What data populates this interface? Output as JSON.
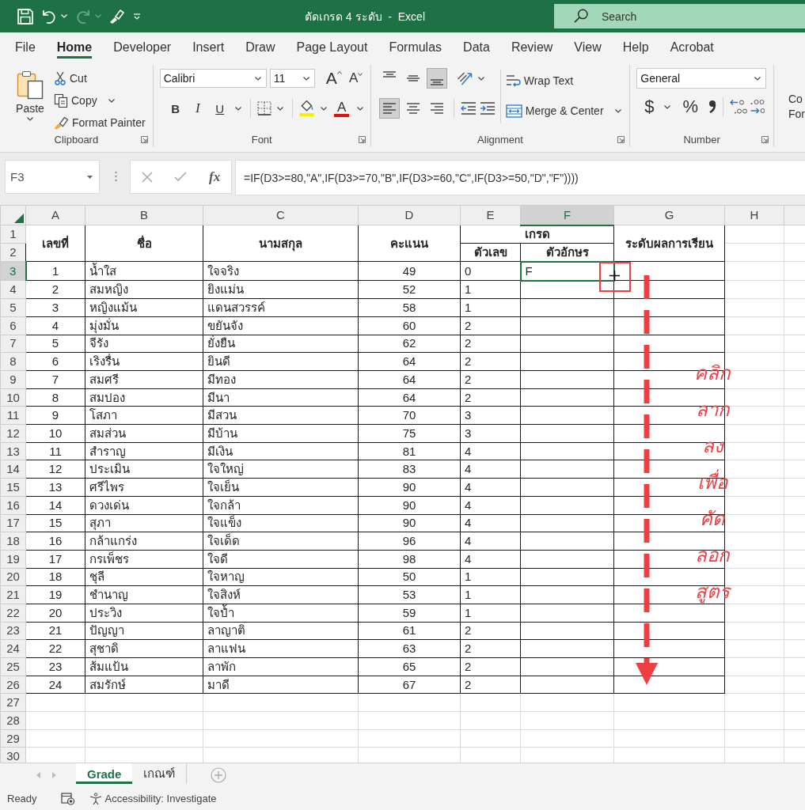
{
  "title_bar": {
    "quick_access": [
      {
        "kind": "save",
        "disabled": false
      },
      {
        "kind": "undo",
        "disabled": false
      },
      {
        "kind": "redo",
        "disabled": true
      },
      {
        "kind": "painter",
        "disabled": false
      },
      {
        "kind": "customize",
        "disabled": false
      }
    ],
    "title": "ตัดเกรด 4 ระดับ  -  Excel",
    "search": {
      "placeholder": "Search"
    }
  },
  "menu_tabs": [
    {
      "label": "File",
      "selected": false
    },
    {
      "label": "Home",
      "selected": true
    },
    {
      "label": "Developer",
      "selected": false
    },
    {
      "label": "Insert",
      "selected": false
    },
    {
      "label": "Draw",
      "selected": false
    },
    {
      "label": "Page Layout",
      "selected": false
    },
    {
      "label": "Formulas",
      "selected": false
    },
    {
      "label": "Data",
      "selected": false
    },
    {
      "label": "Review",
      "selected": false
    },
    {
      "label": "View",
      "selected": false
    },
    {
      "label": "Help",
      "selected": false
    },
    {
      "label": "Acrobat",
      "selected": false
    }
  ],
  "ribbon": {
    "clipboard": {
      "label": "Clipboard",
      "paste": "Paste",
      "cut": "Cut",
      "copy": "Copy",
      "format_painter": "Format Painter"
    },
    "font": {
      "label": "Font",
      "font_name": "Calibri",
      "font_size": "11",
      "grow": "A",
      "shrink": "A",
      "bold": "B",
      "italic": "I",
      "underline": "U",
      "font_color": "A"
    },
    "alignment": {
      "label": "Alignment",
      "vertical": [
        {
          "kind": "top",
          "selected": false
        },
        {
          "kind": "middle",
          "selected": false
        },
        {
          "kind": "bottom",
          "selected": true
        }
      ],
      "horizontal": [
        {
          "kind": "left",
          "selected": true
        },
        {
          "kind": "center",
          "selected": false
        },
        {
          "kind": "right",
          "selected": false
        }
      ],
      "wrap_text": "Wrap Text",
      "merge_center": "Merge & Center"
    },
    "number": {
      "label": "Number",
      "format": "General",
      "currency": "$",
      "percent": "%"
    },
    "next_group": [
      "Co",
      "For"
    ]
  },
  "formula_bar": {
    "name_box": "F3",
    "buttons": [
      {
        "kind": "cancel",
        "disabled": true
      },
      {
        "kind": "enter",
        "disabled": true
      }
    ],
    "function_label": "fx",
    "formula": "=IF(D3>=80,\"A\",IF(D3>=70,\"B\",IF(D3>=60,\"C\",IF(D3>=50,\"D\",\"F\"))))"
  },
  "sheet": {
    "columns": [
      {
        "label": "A",
        "selected": false
      },
      {
        "label": "B",
        "selected": false
      },
      {
        "label": "C",
        "selected": false
      },
      {
        "label": "D",
        "selected": false
      },
      {
        "label": "E",
        "selected": false
      },
      {
        "label": "F",
        "selected": true
      },
      {
        "label": "G",
        "selected": false
      },
      {
        "label": "H",
        "selected": false
      }
    ],
    "header_rows": [
      "1",
      "2"
    ],
    "header": {
      "number": "เลขที่",
      "first_name": "ชื่อ",
      "last_name": "นามสกุล",
      "score": "คะแนน",
      "grade": "เกรด",
      "grade_number": "ตัวเลข",
      "grade_letter": "ตัวอักษร",
      "result_level": "ระดับผลการเรียน"
    },
    "rows": [
      {
        "row": "3",
        "selected": true,
        "no": "1",
        "first_name": "น้ำใส",
        "last_name": "ใจจริง",
        "score": "49",
        "grade_number": "0",
        "grade_letter": "F"
      },
      {
        "row": "4",
        "selected": false,
        "no": "2",
        "first_name": "สมหญิง",
        "last_name": "ยิงแม่น",
        "score": "52",
        "grade_number": "1"
      },
      {
        "row": "5",
        "selected": false,
        "no": "3",
        "first_name": "หญิงแม้น",
        "last_name": "แดนสวรรค์",
        "score": "58",
        "grade_number": "1"
      },
      {
        "row": "6",
        "selected": false,
        "no": "4",
        "first_name": "มุ่งมั่น",
        "last_name": "ขยันจัง",
        "score": "60",
        "grade_number": "2"
      },
      {
        "row": "7",
        "selected": false,
        "no": "5",
        "first_name": "จีรัง",
        "last_name": "ยั่งยืน",
        "score": "62",
        "grade_number": "2"
      },
      {
        "row": "8",
        "selected": false,
        "no": "6",
        "first_name": "เริงรื่น",
        "last_name": "ยินดี",
        "score": "64",
        "grade_number": "2"
      },
      {
        "row": "9",
        "selected": false,
        "no": "7",
        "first_name": "สมศรี",
        "last_name": "มีทอง",
        "score": "64",
        "grade_number": "2"
      },
      {
        "row": "10",
        "selected": false,
        "no": "8",
        "first_name": "สมปอง",
        "last_name": "มีนา",
        "score": "64",
        "grade_number": "2"
      },
      {
        "row": "11",
        "selected": false,
        "no": "9",
        "first_name": "โสภา",
        "last_name": "มีสวน",
        "score": "70",
        "grade_number": "3"
      },
      {
        "row": "12",
        "selected": false,
        "no": "10",
        "first_name": "สมส่วน",
        "last_name": "มีบ้าน",
        "score": "75",
        "grade_number": "3"
      },
      {
        "row": "13",
        "selected": false,
        "no": "11",
        "first_name": "สำราญ",
        "last_name": "มีเงิน",
        "score": "81",
        "grade_number": "4"
      },
      {
        "row": "14",
        "selected": false,
        "no": "12",
        "first_name": "ประเมิน",
        "last_name": "ใจใหญ่",
        "score": "83",
        "grade_number": "4"
      },
      {
        "row": "15",
        "selected": false,
        "no": "13",
        "first_name": "ศรีไพร",
        "last_name": "ใจเย็น",
        "score": "90",
        "grade_number": "4"
      },
      {
        "row": "16",
        "selected": false,
        "no": "14",
        "first_name": "ดวงเด่น",
        "last_name": "ใจกล้า",
        "score": "90",
        "grade_number": "4"
      },
      {
        "row": "17",
        "selected": false,
        "no": "15",
        "first_name": "สุภา",
        "last_name": "ใจแข็ง",
        "score": "90",
        "grade_number": "4"
      },
      {
        "row": "18",
        "selected": false,
        "no": "16",
        "first_name": "กล้าแกร่ง",
        "last_name": "ใจเด็ด",
        "score": "96",
        "grade_number": "4"
      },
      {
        "row": "19",
        "selected": false,
        "no": "17",
        "first_name": "กรเพ็ชร",
        "last_name": "ใจดี",
        "score": "98",
        "grade_number": "4"
      },
      {
        "row": "20",
        "selected": false,
        "no": "18",
        "first_name": "ชุลี",
        "last_name": "ใจหาญ",
        "score": "50",
        "grade_number": "1"
      },
      {
        "row": "21",
        "selected": false,
        "no": "19",
        "first_name": "ชำนาญ",
        "last_name": "ใจสิงห์",
        "score": "53",
        "grade_number": "1"
      },
      {
        "row": "22",
        "selected": false,
        "no": "20",
        "first_name": "ประวิง",
        "last_name": "ใจป้ำ",
        "score": "59",
        "grade_number": "1"
      },
      {
        "row": "23",
        "selected": false,
        "no": "21",
        "first_name": "ปัญญา",
        "last_name": "ลาญาติ",
        "score": "61",
        "grade_number": "2"
      },
      {
        "row": "24",
        "selected": false,
        "no": "22",
        "first_name": "สุชาดิ",
        "last_name": "ลาแฟน",
        "score": "63",
        "grade_number": "2"
      },
      {
        "row": "25",
        "selected": false,
        "no": "23",
        "first_name": "ส้มแป้น",
        "last_name": "ลาพัก",
        "score": "65",
        "grade_number": "2"
      },
      {
        "row": "26",
        "selected": false,
        "no": "24",
        "first_name": "สมรักษ์",
        "last_name": "มาดี",
        "score": "67",
        "grade_number": "2"
      }
    ],
    "empty_rows": [
      "27",
      "28",
      "29",
      "30"
    ]
  },
  "annotation": {
    "words": [
      "คลิก",
      "ลาก",
      "ลง",
      "เพื่อ",
      "คัด",
      "ลอก",
      "สูตร"
    ]
  },
  "sheet_tabs": {
    "nav": [
      {
        "kind": "prev",
        "disabled": true
      },
      {
        "kind": "next",
        "disabled": true
      }
    ],
    "tabs": [
      {
        "label": "Grade",
        "selected": true
      },
      {
        "label": "เกณฑ์",
        "selected": false
      }
    ]
  },
  "status_bar": {
    "status": "Ready",
    "accessibility": "Accessibility: Investigate"
  }
}
